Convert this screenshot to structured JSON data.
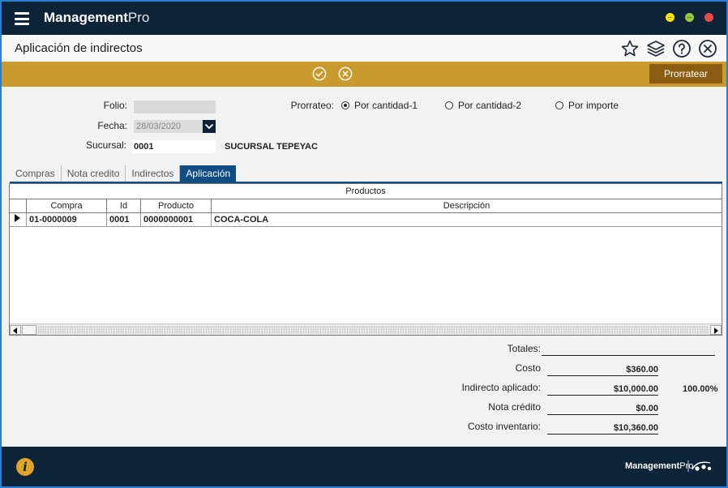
{
  "app": {
    "name_bold": "Management",
    "name_light": "Pro"
  },
  "header": {
    "title": "Aplicación de indirectos"
  },
  "actionbar": {
    "prorratear_label": "Prorratear"
  },
  "form": {
    "folio_label": "Folio:",
    "folio_value": "",
    "fecha_label": "Fecha:",
    "fecha_value": "28/03/2020",
    "sucursal_label": "Sucursal:",
    "sucursal_code": "0001",
    "sucursal_name": "SUCURSAL TEPEYAC",
    "prorrateo_label": "Prorrateo:",
    "prorrateo_options": [
      "Por cantidad-1",
      "Por cantidad-2",
      "Por importe"
    ],
    "prorrateo_selected": "Por cantidad-1"
  },
  "tabs": [
    {
      "label": "Compras",
      "active": false
    },
    {
      "label": "Nota credito",
      "active": false
    },
    {
      "label": "Indirectos",
      "active": false
    },
    {
      "label": "Aplicación",
      "active": true
    }
  ],
  "grid": {
    "group_header": "Productos",
    "columns": [
      "Compra",
      "Id",
      "Producto",
      "Descripción"
    ],
    "rows": [
      {
        "compra": "01-0000009",
        "id": "0001",
        "producto": "0000000001",
        "descripcion": "COCA-COLA"
      }
    ]
  },
  "totals": {
    "title": "Totales:",
    "costo_label": "Costo",
    "costo_value": "$360.00",
    "indirecto_label": "Indirecto aplicado:",
    "indirecto_value": "$10,000.00",
    "indirecto_pct": "100.00%",
    "nota_label": "Nota crédito",
    "nota_value": "$0.00",
    "inventario_label": "Costo inventario:",
    "inventario_value": "$10,360.00"
  },
  "footer": {
    "brand_bold": "Management",
    "brand_light": "Pro"
  },
  "colors": {
    "navy": "#0d2338",
    "gold": "#c99a2e",
    "button_brown": "#8b5d12",
    "tab_active": "#0f4d84",
    "info": "#e0a526"
  }
}
